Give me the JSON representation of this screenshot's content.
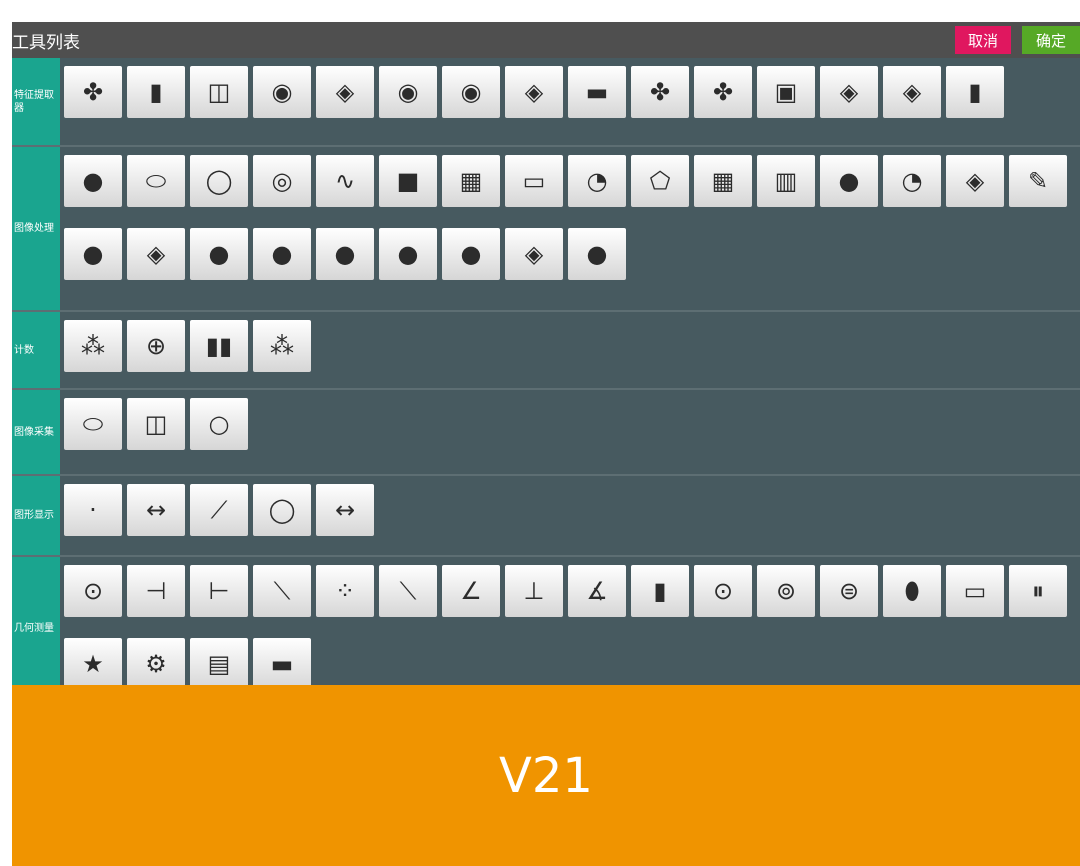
{
  "window": {
    "title": "工具列表"
  },
  "buttons": {
    "cancel": "取消",
    "ok": "确定"
  },
  "banner": {
    "version": "V21"
  },
  "sections": [
    {
      "label": "特征提取器",
      "tools": [
        {
          "icon": "clover-icon",
          "glyph": "✤"
        },
        {
          "icon": "bar-icon",
          "glyph": "▮"
        },
        {
          "icon": "frame-icon",
          "glyph": "◫"
        },
        {
          "icon": "circle-target-icon",
          "glyph": "◉"
        },
        {
          "icon": "diamond-icon",
          "glyph": "◈"
        },
        {
          "icon": "circle-target-icon",
          "glyph": "◉"
        },
        {
          "icon": "circle-target-icon",
          "glyph": "◉"
        },
        {
          "icon": "diamond-icon",
          "glyph": "◈"
        },
        {
          "icon": "dark-image-icon",
          "glyph": "▬"
        },
        {
          "icon": "clover-icon",
          "glyph": "✤"
        },
        {
          "icon": "clover-icon",
          "glyph": "✤"
        },
        {
          "icon": "screen-icon",
          "glyph": "▣"
        },
        {
          "icon": "diamond-icon",
          "glyph": "◈"
        },
        {
          "icon": "diamond-icon",
          "glyph": "◈"
        },
        {
          "icon": "bar-icon",
          "glyph": "▮"
        }
      ]
    },
    {
      "label": "图像处理",
      "tools": [
        {
          "icon": "blobs-icon",
          "glyph": "●"
        },
        {
          "icon": "ellipse-icon",
          "glyph": "⬭"
        },
        {
          "icon": "ellipse-icon",
          "glyph": "◯"
        },
        {
          "icon": "red-target-icon",
          "glyph": "◎"
        },
        {
          "icon": "wave-icon",
          "glyph": "∿"
        },
        {
          "icon": "dark-screen-icon",
          "glyph": "■"
        },
        {
          "icon": "grid-icon",
          "glyph": "▦"
        },
        {
          "icon": "window-icon",
          "glyph": "▭"
        },
        {
          "icon": "gauge-icon",
          "glyph": "◔"
        },
        {
          "icon": "shape-icon",
          "glyph": "⬠"
        },
        {
          "icon": "grid-icon",
          "glyph": "▦"
        },
        {
          "icon": "bars-icon",
          "glyph": "▥"
        },
        {
          "icon": "blobs-icon",
          "glyph": "●"
        },
        {
          "icon": "gauge-icon",
          "glyph": "◔"
        },
        {
          "icon": "diamond-icon",
          "glyph": "◈"
        },
        {
          "icon": "caliper-icon",
          "glyph": "✎"
        },
        {
          "icon": "blobs-icon",
          "glyph": "●"
        },
        {
          "icon": "diamond-icon",
          "glyph": "◈"
        },
        {
          "icon": "blobs-icon",
          "glyph": "●"
        },
        {
          "icon": "blobs-icon",
          "glyph": "●"
        },
        {
          "icon": "blobs-icon",
          "glyph": "●"
        },
        {
          "icon": "blobs-icon",
          "glyph": "●"
        },
        {
          "icon": "blobs-icon",
          "glyph": "●"
        },
        {
          "icon": "diamond-icon",
          "glyph": "◈"
        },
        {
          "icon": "blobs-icon",
          "glyph": "●"
        }
      ]
    },
    {
      "label": "计数",
      "tools": [
        {
          "icon": "multi-blob-icon",
          "glyph": "⁂"
        },
        {
          "icon": "add-blob-icon",
          "glyph": "⊕"
        },
        {
          "icon": "columns-icon",
          "glyph": "▮▮"
        },
        {
          "icon": "multi-blob-icon",
          "glyph": "⁂"
        }
      ]
    },
    {
      "label": "图像采集",
      "tools": [
        {
          "icon": "ellipse-icon",
          "glyph": "⬭"
        },
        {
          "icon": "frame-icon",
          "glyph": "◫"
        },
        {
          "icon": "circle-icon",
          "glyph": "○"
        }
      ]
    },
    {
      "label": "图形显示",
      "tools": [
        {
          "icon": "dot-icon",
          "glyph": "·"
        },
        {
          "icon": "measure-icon",
          "glyph": "↔"
        },
        {
          "icon": "line-icon",
          "glyph": "⟋"
        },
        {
          "icon": "circle-icon",
          "glyph": "◯"
        },
        {
          "icon": "measure-icon",
          "glyph": "↔"
        }
      ]
    },
    {
      "label": "几何测量",
      "tools": [
        {
          "icon": "point-circle-icon",
          "glyph": "⊙"
        },
        {
          "icon": "point-line-icon",
          "glyph": "⊣"
        },
        {
          "icon": "point-line-icon",
          "glyph": "⊢"
        },
        {
          "icon": "line-icon",
          "glyph": "⟍"
        },
        {
          "icon": "points-icon",
          "glyph": "⁘"
        },
        {
          "icon": "line-icon",
          "glyph": "⟍"
        },
        {
          "icon": "angle-icon",
          "glyph": "∠"
        },
        {
          "icon": "base-line-icon",
          "glyph": "⊥"
        },
        {
          "icon": "angle-icon",
          "glyph": "∡"
        },
        {
          "icon": "green-bar-icon",
          "glyph": "▮"
        },
        {
          "icon": "circle-icon",
          "glyph": "⊙"
        },
        {
          "icon": "circle-point-icon",
          "glyph": "⊚"
        },
        {
          "icon": "ring-icon",
          "glyph": "⊜"
        },
        {
          "icon": "lens-icon",
          "glyph": "⬮"
        },
        {
          "icon": "slot-icon",
          "glyph": "▭"
        },
        {
          "icon": "pause-icon",
          "glyph": "⏸"
        },
        {
          "icon": "star-icon",
          "glyph": "★"
        },
        {
          "icon": "gear-icon",
          "glyph": "⚙"
        },
        {
          "icon": "slot-icon",
          "glyph": "▤"
        },
        {
          "icon": "slot-icon",
          "glyph": "▬"
        }
      ]
    }
  ]
}
